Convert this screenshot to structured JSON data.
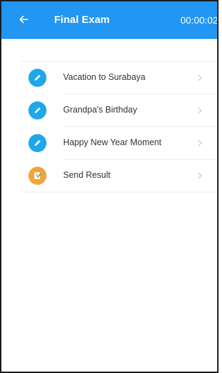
{
  "appbar": {
    "title": "Final Exam",
    "timer": "00:00:02",
    "back_icon": "arrow-left-icon",
    "color": "#2196f3"
  },
  "list": {
    "items": [
      {
        "label": "Vacation to Surabaya",
        "icon": "pencil-icon",
        "icon_color": "#1fa7e8"
      },
      {
        "label": "Grandpa's Birthday",
        "icon": "pencil-icon",
        "icon_color": "#1fa7e8"
      },
      {
        "label": "Happy New Year Moment",
        "icon": "pencil-icon",
        "icon_color": "#1fa7e8"
      },
      {
        "label": "Send Result",
        "icon": "note-edit-icon",
        "icon_color": "#f2a33a"
      }
    ],
    "chevron_icon": "chevron-right-icon"
  }
}
